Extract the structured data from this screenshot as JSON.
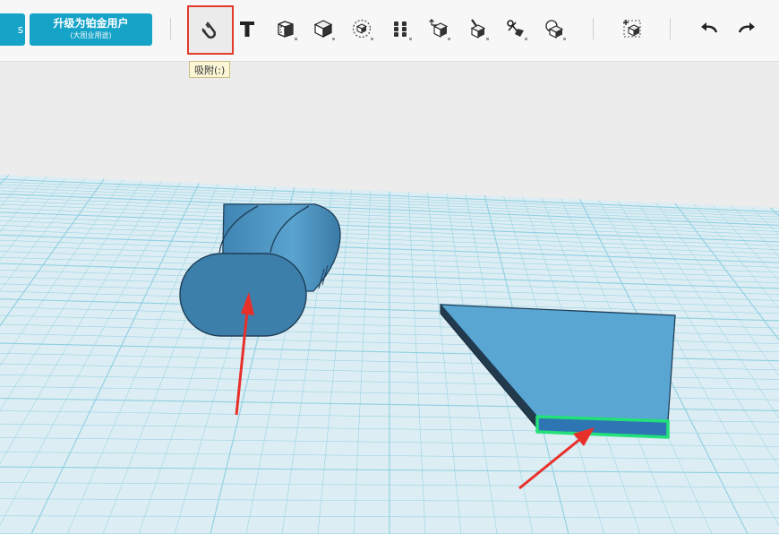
{
  "toolbar": {
    "left_button_label": "s",
    "upgrade_button": {
      "title": "升级为铂金用户",
      "subtitle": "(大图业用途)"
    },
    "tools": [
      {
        "name": "snap-magnet-tool",
        "icon": "magnet-icon",
        "active": true
      },
      {
        "name": "text-tool",
        "icon": "text-t-icon"
      },
      {
        "name": "measure-tool",
        "icon": "ruler-cube-icon"
      },
      {
        "name": "primitive-tool",
        "icon": "cube-icon"
      },
      {
        "name": "select-tool",
        "icon": "dashed-cube-icon"
      },
      {
        "name": "array-tool",
        "icon": "grid-cubes-icon"
      },
      {
        "name": "move-tool",
        "icon": "move-cube-icon"
      },
      {
        "name": "pen-tool",
        "icon": "pen-cube-icon"
      },
      {
        "name": "split-tool",
        "icon": "cut-icon"
      },
      {
        "name": "combine-tool",
        "icon": "combine-icon"
      },
      {
        "name": "add-object-tool",
        "icon": "add-cube-icon"
      },
      {
        "name": "undo-button",
        "icon": "undo-arrow-icon"
      },
      {
        "name": "redo-button",
        "icon": "redo-arrow-icon"
      }
    ],
    "tooltip": "吸附(:)"
  },
  "scene": {
    "grid_color": "#8fd0e2",
    "model_color": "#4a8fbb",
    "highlight_color": "#23e07a",
    "annotation_color": "#e8302a",
    "objects": [
      "rounded-capsule",
      "wedge-plate"
    ]
  }
}
